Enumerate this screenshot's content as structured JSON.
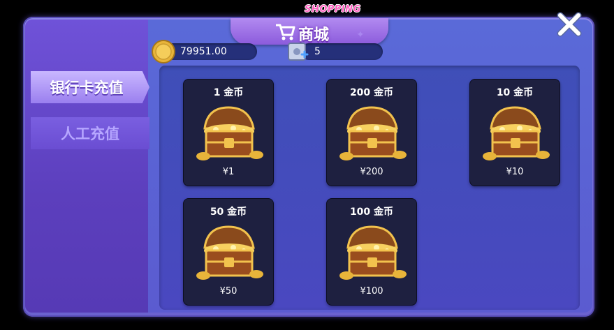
{
  "header": {
    "title": "商城",
    "subtitle": "SHOPPING",
    "icon": "shopping-cart-icon",
    "close_icon": "close-icon"
  },
  "currency": {
    "gold": "79951.00",
    "gold_icon": "gold-coin-icon",
    "bank": "5",
    "bank_icon": "safe-box-icon"
  },
  "tabs": [
    {
      "label": "银行卡充值",
      "active": true
    },
    {
      "label": "人工充值",
      "active": false
    }
  ],
  "products": [
    {
      "label": "1 金币",
      "price": "¥1"
    },
    {
      "label": "200 金币",
      "price": "¥200"
    },
    {
      "label": "10 金币",
      "price": "¥10"
    },
    {
      "label": "50 金币",
      "price": "¥50"
    },
    {
      "label": "100 金币",
      "price": "¥100"
    }
  ],
  "colors": {
    "accent": "#8c5bdc",
    "panel": "#4a48c0",
    "card": "#1e2040",
    "gold": "#e8b43a"
  }
}
